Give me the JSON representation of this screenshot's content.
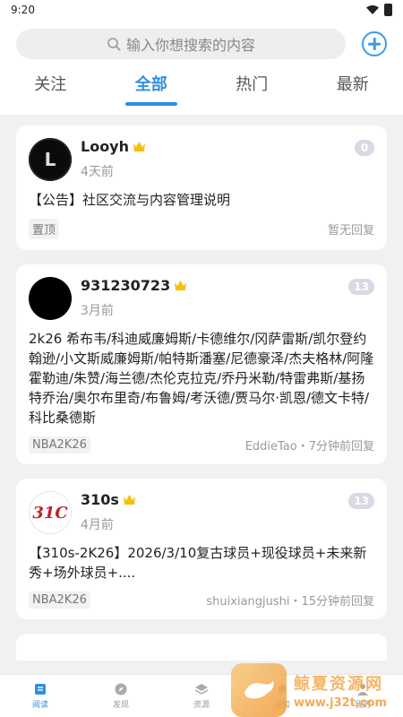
{
  "status_bar": {
    "time": "9:20"
  },
  "search": {
    "placeholder": "输入你想搜索的内容"
  },
  "tabs": [
    {
      "label": "关注",
      "active": false
    },
    {
      "label": "全部",
      "active": true
    },
    {
      "label": "热门",
      "active": false
    },
    {
      "label": "最新",
      "active": false
    }
  ],
  "posts": [
    {
      "author": "Looyh",
      "avatar_letter": "L",
      "time": "4天前",
      "count": "0",
      "content": "【公告】社区交流与内容管理说明",
      "tag": "置顶",
      "reply": "暂无回复"
    },
    {
      "author": "931230723",
      "time": "3月前",
      "count": "13",
      "content": "2k26 希布韦/科迪威廉姆斯/卡德维尔/冈萨雷斯/凯尔登约翰逊/小文斯威廉姆斯/帕特斯潘塞/尼德豪泽/杰夫格林/阿隆霍勒迪/朱赞/海兰德/杰伦克拉克/乔丹米勒/特雷弗斯/基扬特乔治/奥尔布里奇/布鲁姆/考沃德/贾马尔·凯恩/德文卡特/科比桑德斯",
      "tag": "NBA2K26",
      "reply": "EddieTao・7分钟前回复"
    },
    {
      "author": "310s",
      "avatar_text": "31C",
      "time": "4月前",
      "count": "13",
      "content": "【310s-2K26】2026/3/10复古球员+现役球员+未来新秀+场外球员+....",
      "tag": "NBA2K26",
      "reply": "shuixiangjushi・15分钟前回复"
    }
  ],
  "bottom_nav": [
    {
      "label": "阅读",
      "active": true
    },
    {
      "label": "发现",
      "active": false
    },
    {
      "label": "资源",
      "active": false
    },
    {
      "label": "通知",
      "active": false
    },
    {
      "label": "我的",
      "active": false
    }
  ],
  "watermark": {
    "title": "鲸夏资源网",
    "url": "www.j32t.com"
  }
}
